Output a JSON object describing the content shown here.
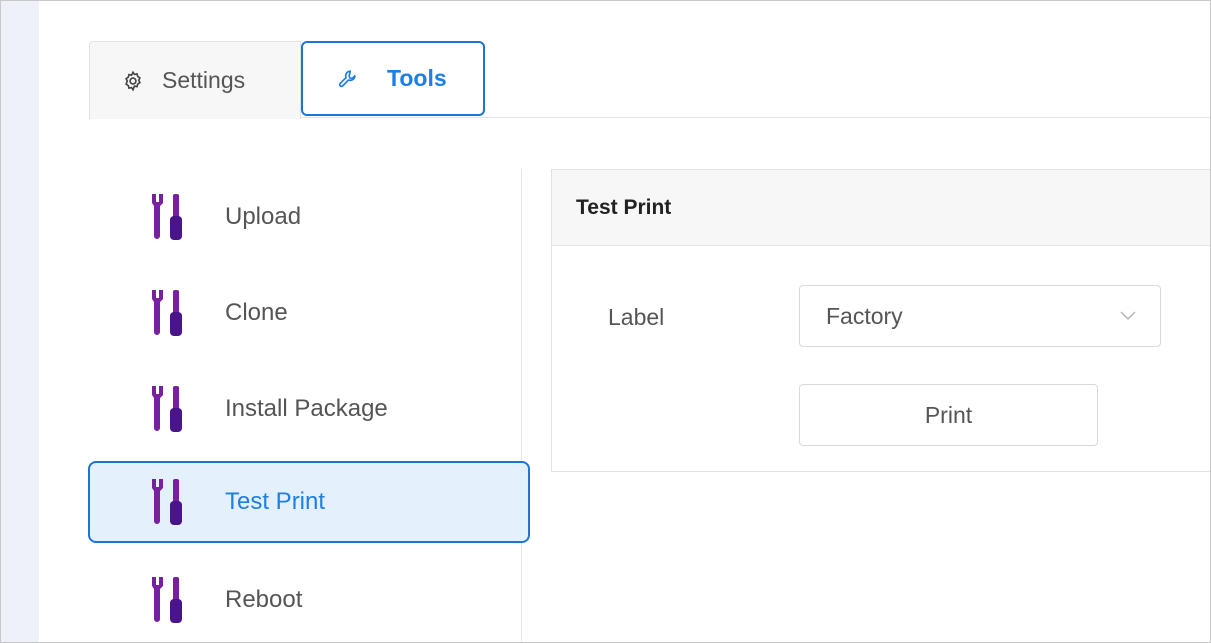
{
  "tabs": {
    "settings": {
      "label": "Settings",
      "icon": "gear-icon"
    },
    "tools": {
      "label": "Tools",
      "icon": "wrench-icon",
      "active": true
    }
  },
  "sidebar": {
    "items": [
      {
        "label": "Upload",
        "icon": "tools-icon",
        "active": false
      },
      {
        "label": "Clone",
        "icon": "tools-icon",
        "active": false
      },
      {
        "label": "Install Package",
        "icon": "tools-icon",
        "active": false
      },
      {
        "label": "Test Print",
        "icon": "tools-icon",
        "active": true
      },
      {
        "label": "Reboot",
        "icon": "tools-icon",
        "active": false
      }
    ]
  },
  "panel": {
    "title": "Test Print",
    "label_field": {
      "label": "Label",
      "value": "Factory"
    },
    "print_button": "Print"
  },
  "colors": {
    "accent": "#1e74d6",
    "active_bg": "#e4f1fd",
    "tool_icon": "#7b1fa2"
  }
}
